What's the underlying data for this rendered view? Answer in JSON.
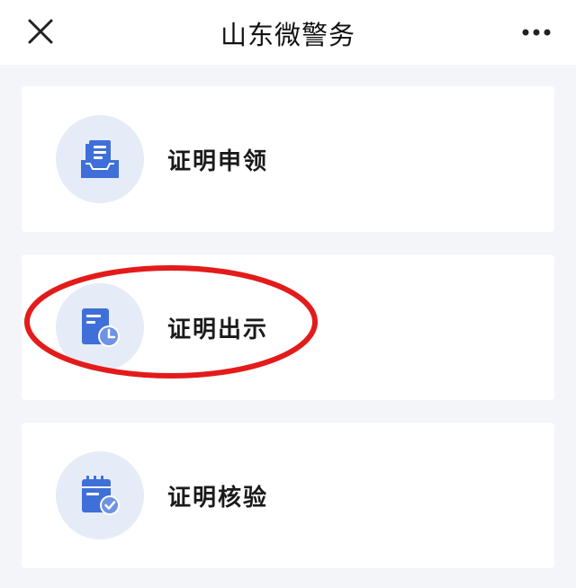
{
  "header": {
    "title": "山东微警务",
    "close_icon": "close-icon",
    "more_icon": "more-dots-icon"
  },
  "menu": {
    "items": [
      {
        "label": "证明申领",
        "icon": "certificate-apply-icon"
      },
      {
        "label": "证明出示",
        "icon": "certificate-show-icon"
      },
      {
        "label": "证明核验",
        "icon": "certificate-verify-icon"
      }
    ]
  },
  "colors": {
    "icon_blue": "#3f6fd8",
    "icon_bg": "#e6ecf7",
    "annotation_red": "#e31b1b",
    "page_bg": "#f4f5f9"
  }
}
